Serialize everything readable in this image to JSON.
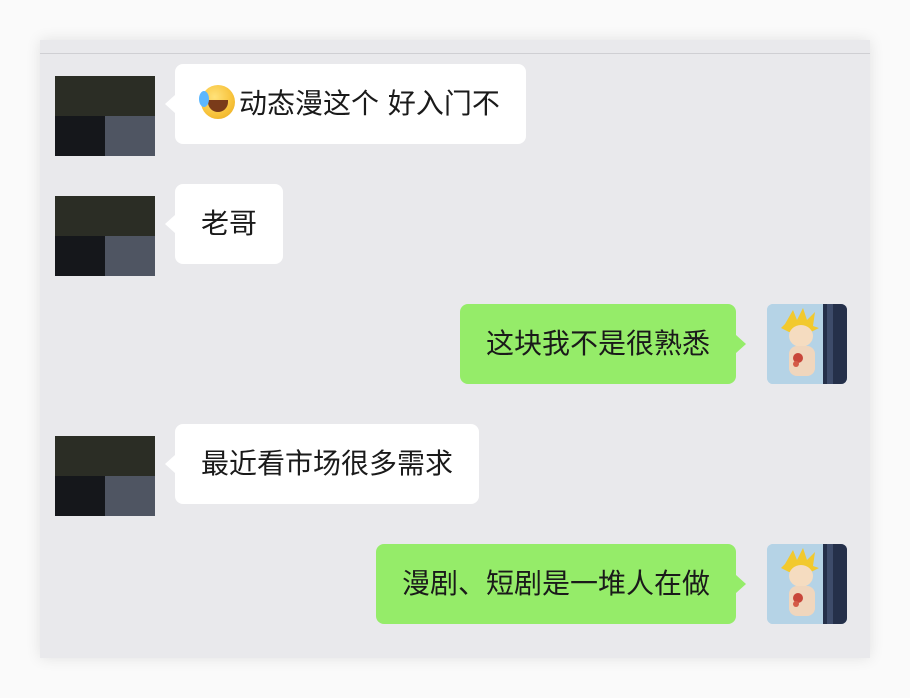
{
  "chat": {
    "messages": [
      {
        "side": "in",
        "emoji": "crying-laughing-emoji",
        "text": "动态漫这个 好入门不"
      },
      {
        "side": "in",
        "text": "老哥"
      },
      {
        "side": "out",
        "text": "这块我不是很熟悉"
      },
      {
        "side": "in",
        "text": "最近看市场很多需求"
      },
      {
        "side": "out",
        "text": "漫剧、短剧是一堆人在做"
      }
    ]
  },
  "colors": {
    "incoming_bubble": "#ffffff",
    "outgoing_bubble": "#95ec69",
    "chat_background": "#e9e9ec"
  }
}
